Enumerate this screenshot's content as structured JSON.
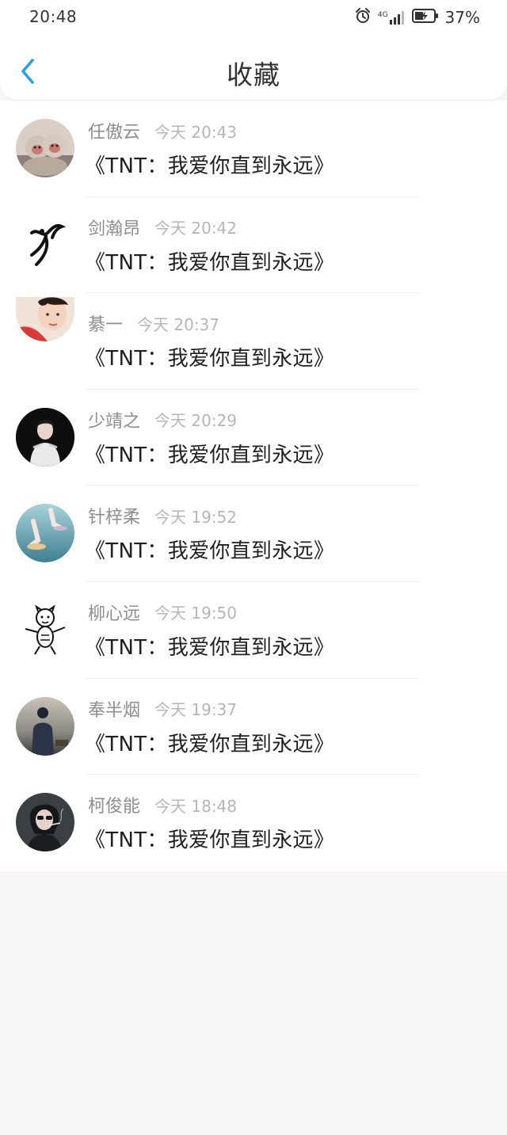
{
  "status_bar": {
    "time": "20:48",
    "network_label": "4G",
    "battery_percent": "37%"
  },
  "nav": {
    "title": "收藏",
    "back_icon": "chevron-left-icon",
    "accent_color": "#2a9ce8"
  },
  "items": [
    {
      "name": "任傲云",
      "time": "今天 20:43",
      "message": "《TNT：我爱你直到永远》",
      "avatar": "two-monkeys"
    },
    {
      "name": "剑瀚昂",
      "time": "今天 20:42",
      "message": "《TNT：我爱你直到永远》",
      "avatar": "ink-dancer"
    },
    {
      "name": "綦一",
      "time": "今天 20:37",
      "message": "《TNT：我爱你直到永远》",
      "avatar": "boy-portrait"
    },
    {
      "name": "少靖之",
      "time": "今天 20:29",
      "message": "《TNT：我爱你直到永远》",
      "avatar": "figure-dark-bg"
    },
    {
      "name": "针梓柔",
      "time": "今天 19:52",
      "message": "《TNT：我爱你直到永远》",
      "avatar": "sandal-feet"
    },
    {
      "name": "柳心远",
      "time": "今天 19:50",
      "message": "《TNT：我爱你直到永远》",
      "avatar": "tiger-sketch"
    },
    {
      "name": "奉半烟",
      "time": "今天 19:37",
      "message": "《TNT：我爱你直到永远》",
      "avatar": "man-back-view"
    },
    {
      "name": "柯俊能",
      "time": "今天 18:48",
      "message": "《TNT：我爱你直到永远》",
      "avatar": "woman-smoking"
    }
  ]
}
